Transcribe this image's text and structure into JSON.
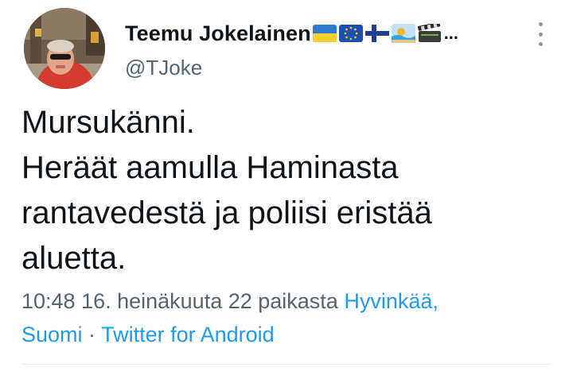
{
  "author": {
    "display_name": "Teemu Jokelainen",
    "handle": "@TJoke",
    "name_emojis": [
      "ukraine-flag",
      "eu-flag",
      "finland-flag",
      "beach-emoji",
      "clapperboard-emoji"
    ],
    "name_overflow": "..."
  },
  "tweet": {
    "lines": [
      "Mursukänni.",
      "Heräät aamulla Haminasta",
      "rantavedestä ja poliisi eristää",
      "aluetta."
    ]
  },
  "meta": {
    "time_date": "10:48 16. heinäkuuta 22 paikasta",
    "location_part1": "Hyvinkää,",
    "location_part2": "Suomi",
    "separator": "·",
    "client": "Twitter for Android"
  },
  "colors": {
    "text": "#0f1419",
    "secondary": "#536471",
    "link": "#1d9bf0",
    "divider": "#e6e9eb"
  }
}
